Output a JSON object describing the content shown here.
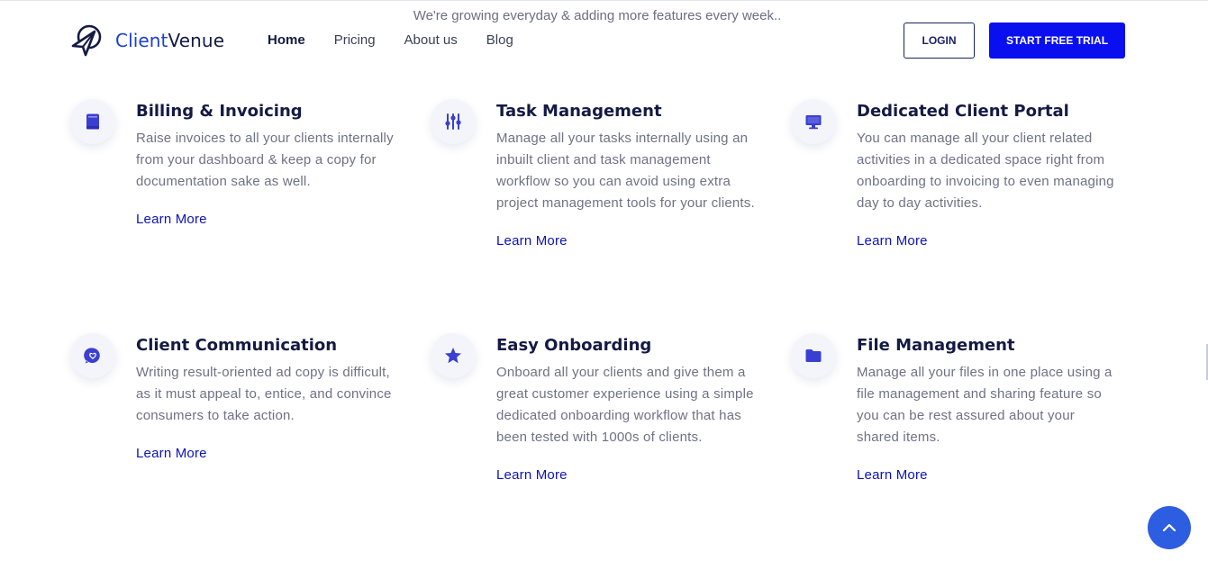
{
  "announcement": "We're growing everyday & adding more features every week..",
  "brand": {
    "name_part1": "Client",
    "name_part2": "Venue",
    "accent_color": "#1d3fd1"
  },
  "nav": {
    "items": [
      {
        "label": "Home",
        "active": true
      },
      {
        "label": "Pricing",
        "active": false
      },
      {
        "label": "About us",
        "active": false
      },
      {
        "label": "Blog",
        "active": false
      }
    ]
  },
  "actions": {
    "login_label": "LOGIN",
    "trial_label": "START FREE TRIAL",
    "trial_color": "#0a0ff0"
  },
  "features": [
    {
      "icon": "book-icon",
      "title": "Billing & Invoicing",
      "description": "Raise invoices to all your clients internally from your dashboard & keep a copy for documentation sake as well.",
      "link": "Learn More"
    },
    {
      "icon": "sliders-icon",
      "title": "Task Management",
      "description": "Manage all your tasks internally using an inbuilt client and task management workflow so you can avoid using extra project management tools for your clients.",
      "link": "Learn More"
    },
    {
      "icon": "monitor-icon",
      "title": "Dedicated Client Portal",
      "description": "You can manage all your client related activities in a dedicated space right from onboarding to invoicing to even managing day to day activities.",
      "link": "Learn More"
    },
    {
      "icon": "heart-chat-icon",
      "title": "Client Communication",
      "description": "Writing result-oriented ad copy is difficult, as it must appeal to, entice, and convince consumers to take action.",
      "link": "Learn More"
    },
    {
      "icon": "star-icon",
      "title": "Easy Onboarding",
      "description": "Onboard all your clients and give them a great customer experience using a simple dedicated onboarding workflow that has been tested with 1000s of clients.",
      "link": "Learn More"
    },
    {
      "icon": "folder-icon",
      "title": "File Management",
      "description": "Manage all your files in one place using a file management and sharing feature so you can be rest assured about your shared items.",
      "link": "Learn More"
    }
  ],
  "scroll_top_icon": "chevron-up-icon",
  "colors": {
    "icon": "#3a3fd1",
    "link": "#0c13b8",
    "heading": "#141a44",
    "body": "#6e7285",
    "scroll_button": "#2d5de0"
  }
}
